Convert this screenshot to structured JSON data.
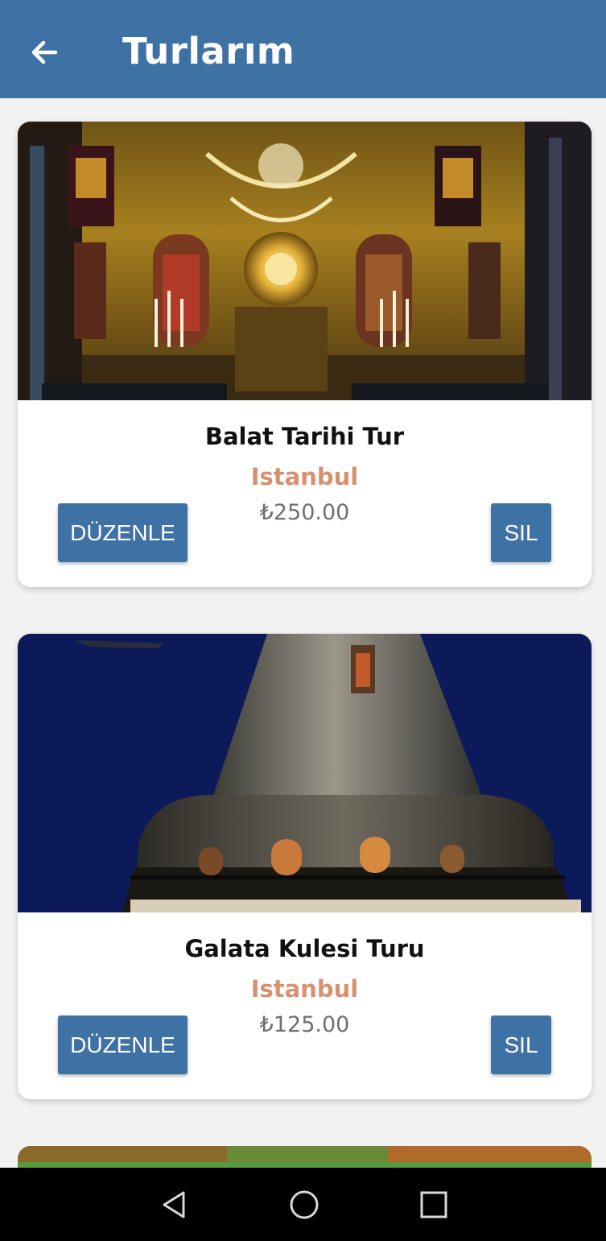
{
  "header": {
    "title": "Turlarım",
    "back_icon": "arrow-left-icon",
    "background": "#3e72a4"
  },
  "tours": [
    {
      "name": "Balat Tarihi Tur",
      "city": "Istanbul",
      "price": "₺250.00",
      "edit_label": "DÜZENLE",
      "delete_label": "SIL"
    },
    {
      "name": "Galata Kulesi Turu",
      "city": "Istanbul",
      "price": "₺125.00",
      "edit_label": "DÜZENLE",
      "delete_label": "SIL"
    }
  ],
  "colors": {
    "accent": "#3e72a4",
    "city": "#d9906e",
    "price": "#6f6f6f"
  },
  "system_nav": {
    "back_icon": "triangle-back-icon",
    "home_icon": "circle-home-icon",
    "recents_icon": "square-recents-icon"
  }
}
